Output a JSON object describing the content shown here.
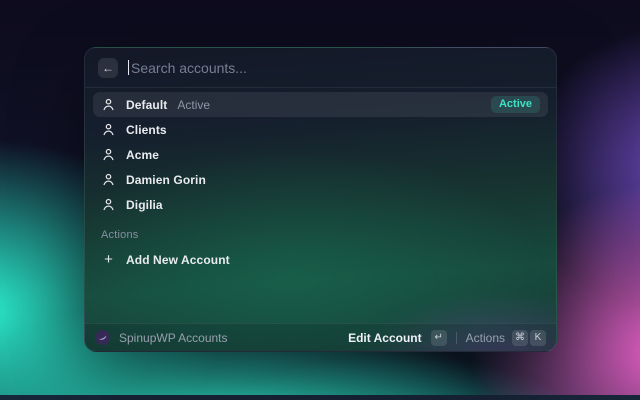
{
  "window": {
    "search": {
      "placeholder": "Search accounts...",
      "back_icon": "arrow-left"
    },
    "accounts": [
      {
        "name": "Default",
        "subtitle": "Active",
        "badge": "Active",
        "selected": true
      },
      {
        "name": "Clients"
      },
      {
        "name": "Acme"
      },
      {
        "name": "Damien Gorin"
      },
      {
        "name": "Digilia"
      }
    ],
    "actions_header": "Actions",
    "add_action": {
      "label": "Add New Account",
      "icon": "plus"
    },
    "footer": {
      "app_name": "SpinupWP Accounts",
      "primary_action": "Edit Account",
      "primary_key": "↵",
      "secondary_action": "Actions",
      "secondary_keys": [
        "⌘",
        "K"
      ]
    },
    "colors": {
      "accent_teal": "#40e2c5",
      "selected_row": "rgba(255,255,255,0.08)"
    }
  }
}
